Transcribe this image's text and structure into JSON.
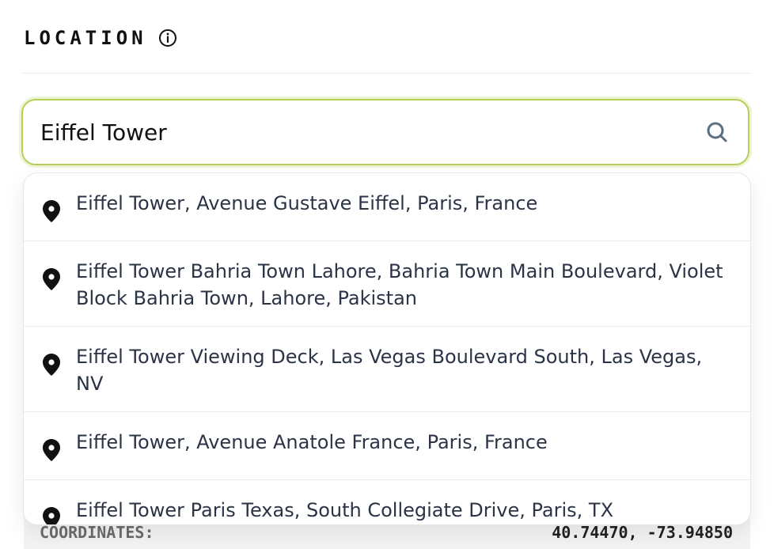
{
  "header": {
    "title": "LOCATION"
  },
  "search": {
    "value": "Eiffel Tower"
  },
  "suggestions": [
    "Eiffel Tower, Avenue Gustave Eiffel, Paris, France",
    "Eiffel Tower Bahria Town Lahore, Bahria Town Main Boulevard, Violet Block Bahria Town, Lahore, Pakistan",
    "Eiffel Tower Viewing Deck, Las Vegas Boulevard South, Las Vegas, NV",
    "Eiffel Tower, Avenue Anatole France, Paris, France",
    "Eiffel Tower Paris Texas, South Collegiate Drive, Paris, TX"
  ],
  "coordinates": {
    "label": "COORDINATES:",
    "value": "40.74470, -73.94850"
  },
  "colors": {
    "accent": "#b3cf58",
    "text": "#2b3446"
  }
}
